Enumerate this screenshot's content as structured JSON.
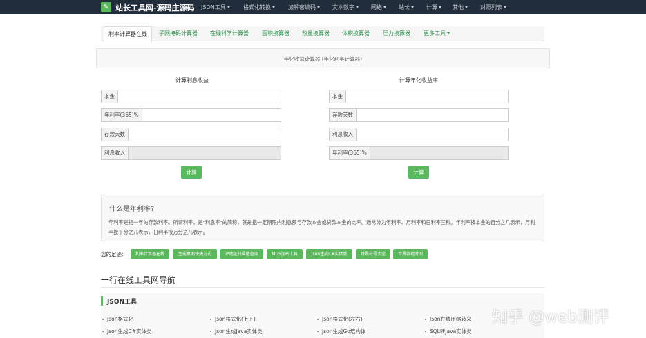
{
  "header": {
    "brand_icon": "wrench-icon",
    "brand_title": "站长工具网-源码庄源码",
    "nav": [
      "JSON工具",
      "格式化转换",
      "加解密编码",
      "文本数字",
      "网络",
      "站长",
      "计算",
      "其他",
      "对照列表"
    ]
  },
  "tabs": [
    {
      "label": "利率计算器在线",
      "active": true
    },
    {
      "label": "子网掩码计算器",
      "active": false
    },
    {
      "label": "在线科学计算器",
      "active": false
    },
    {
      "label": "面积换算器",
      "active": false
    },
    {
      "label": "热量换算器",
      "active": false
    },
    {
      "label": "体积换算器",
      "active": false
    },
    {
      "label": "压力换算器",
      "active": false
    },
    {
      "label": "更多工具",
      "active": false,
      "dropdown": true
    }
  ],
  "banner": "年化收益计算器 (年化利率计算器)",
  "left_form": {
    "title": "计算利息收益",
    "fields": [
      {
        "label": "本金",
        "value": ""
      },
      {
        "label": "年利率(365)%",
        "value": ""
      },
      {
        "label": "存款天数",
        "value": ""
      },
      {
        "label": "利息收入",
        "value": "",
        "readonly": true
      }
    ],
    "button": "计算"
  },
  "right_form": {
    "title": "计算年化收益率",
    "fields": [
      {
        "label": "本金",
        "value": ""
      },
      {
        "label": "存款天数",
        "value": ""
      },
      {
        "label": "利息收入",
        "value": ""
      },
      {
        "label": "年利率(365)%",
        "value": "",
        "readonly": true
      }
    ],
    "button": "计算"
  },
  "info": {
    "title": "什么是年利率?",
    "text": "年利率是指一年的存款利率。所谓利率，是\"利息率\"的简称，就是指一定期限内利息额与存款本金或贷款本金的比率。通常分为年利率、月利率和日利率三种。年利率按本金的百分之几表示，月利率按千分之几表示，日利率按万分之几表示。"
  },
  "footprint": {
    "label": "您的足迹:",
    "items": [
      "利率计算器在线",
      "生成桌面快捷方式",
      "IP地址归属地查询",
      "MD5加密工具",
      "Json生成C#实体类",
      "特殊符号大全",
      "世界各地时间"
    ]
  },
  "section_heading": "一行在线工具网导航",
  "json_tools": {
    "title": "JSON工具",
    "links": [
      "Json格式化",
      "Json格式化(上下)",
      "Json格式化(左右)",
      "Json在线压缩转义",
      "Json生成C#实体类",
      "Json生成Java实体类",
      "Json生成Go结构体",
      "SQL转Java实体类"
    ]
  },
  "watermark": "知乎 @web测评",
  "colors": {
    "nav_bg": "#222d3c",
    "accent": "#5cb85c",
    "tab_text": "#2a8f4a"
  }
}
